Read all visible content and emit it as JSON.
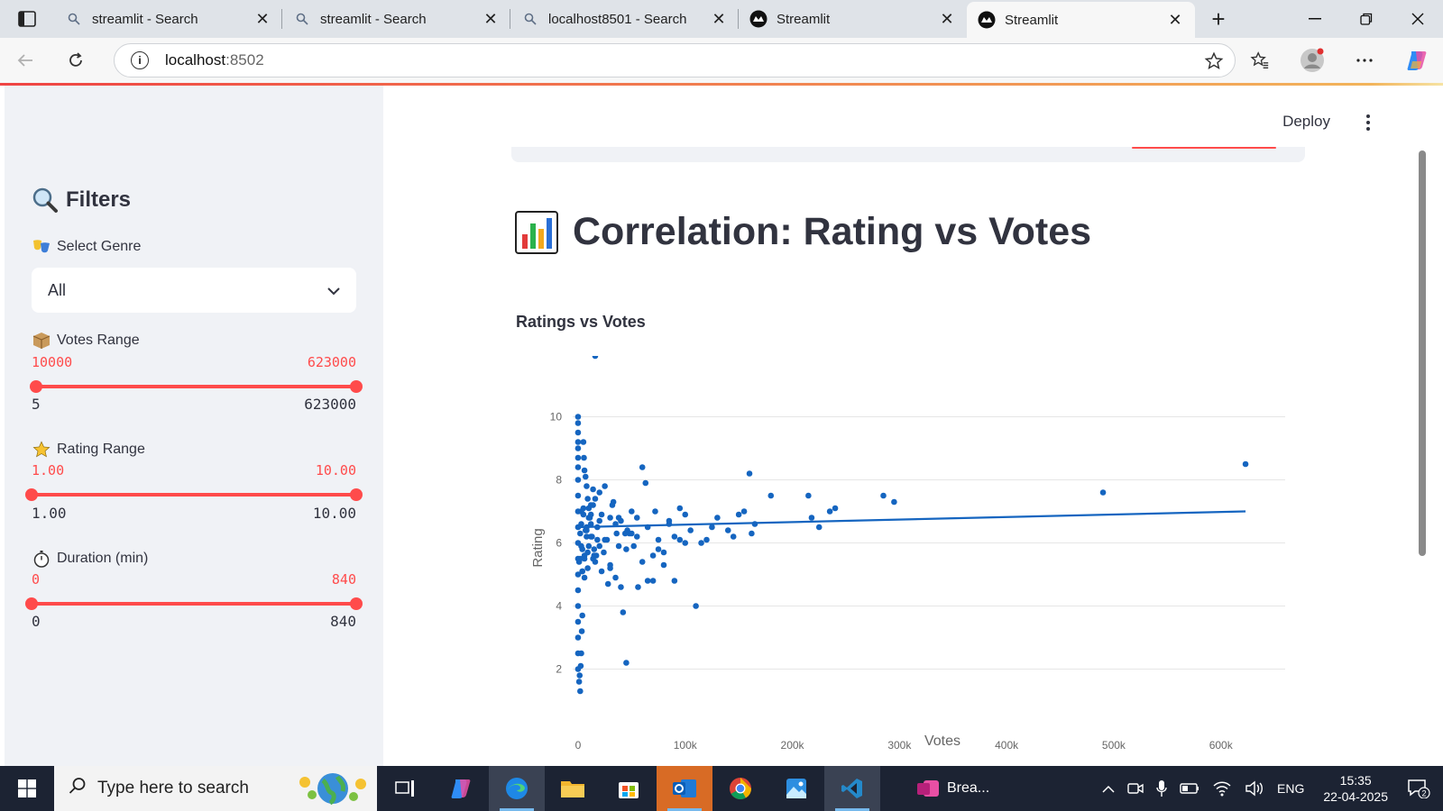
{
  "browser": {
    "tabs": [
      {
        "label": "streamlit - Search",
        "icon": "search-icon"
      },
      {
        "label": "streamlit - Search",
        "icon": "search-icon"
      },
      {
        "label": "localhost8501 - Search",
        "icon": "search-icon"
      },
      {
        "label": "Streamlit",
        "icon": "streamlit-icon"
      },
      {
        "label": "Streamlit",
        "icon": "streamlit-icon",
        "active": true
      }
    ],
    "url_host": "localhost",
    "url_port": ":8502"
  },
  "sidebar": {
    "title": "Filters",
    "genre_label": "Select Genre",
    "genre_value": "All",
    "votes": {
      "label": "Votes Range",
      "low": "10000",
      "high": "623000",
      "min": "5",
      "max": "623000",
      "low_frac": 0.0,
      "high_frac": 1.0
    },
    "rating": {
      "label": "Rating Range",
      "low": "1.00",
      "high": "10.00",
      "min": "1.00",
      "max": "10.00",
      "low_frac": 0.0,
      "high_frac": 1.0
    },
    "duration": {
      "label": "Duration (min)",
      "low": "0",
      "high": "840",
      "min": "0",
      "max": "840",
      "low_frac": 0.0,
      "high_frac": 1.0
    }
  },
  "main": {
    "deploy_label": "Deploy",
    "page_title": "Correlation: Rating vs Votes",
    "chart_title": "Ratings vs Votes"
  },
  "chart_data": {
    "type": "scatter",
    "title": "Ratings vs Votes",
    "xlabel": "Votes",
    "ylabel": "Rating",
    "xlim": [
      -5000,
      660000
    ],
    "ylim": [
      0.5,
      10.5
    ],
    "x_ticks": [
      0,
      100000,
      200000,
      300000,
      400000,
      500000,
      600000
    ],
    "x_tick_labels": [
      "0",
      "100k",
      "200k",
      "300k",
      "400k",
      "500k",
      "600k"
    ],
    "y_ticks": [
      2,
      4,
      6,
      8,
      10
    ],
    "y_tick_labels": [
      "2",
      "4",
      "6",
      "8",
      "10"
    ],
    "grid": true,
    "point_color": "#1565c0",
    "trendline": {
      "x": [
        0,
        623000
      ],
      "y": [
        6.5,
        7.0
      ]
    },
    "points": {
      "x": [
        0,
        0,
        0,
        0,
        0,
        0,
        0,
        0,
        0,
        0,
        0,
        0,
        0,
        0,
        0,
        0,
        0,
        0,
        0,
        0,
        1000,
        1500,
        2000,
        2500,
        3000,
        3500,
        4000,
        5000,
        5500,
        6000,
        7000,
        8000,
        9000,
        10000,
        11000,
        12000,
        14000,
        15000,
        16000,
        18000,
        20000,
        22000,
        25000,
        27000,
        30000,
        32000,
        35000,
        38000,
        40000,
        42000,
        45000,
        48000,
        50000,
        55000,
        60000,
        63000,
        65000,
        70000,
        72000,
        75000,
        80000,
        85000,
        90000,
        95000,
        100000,
        105000,
        110000,
        115000,
        120000,
        125000,
        130000,
        140000,
        145000,
        150000,
        155000,
        160000,
        162000,
        165000,
        180000,
        215000,
        218000,
        225000,
        235000,
        240000,
        285000,
        295000,
        490000,
        623000,
        3000,
        4000,
        6000,
        8000,
        10000,
        12000,
        15000,
        20000,
        25000,
        30000,
        35000,
        40000,
        45000,
        50000,
        55000,
        60000,
        70000,
        80000,
        90000,
        100000,
        5000,
        7000,
        9000,
        13000,
        17000,
        22000,
        28000,
        33000,
        38000,
        44000,
        52000,
        2000,
        3000,
        5000,
        8000,
        12000,
        16000,
        20000,
        4000,
        6000,
        9000,
        14000,
        18000,
        24000,
        30000,
        36000,
        46000,
        56000,
        65000,
        75000,
        85000,
        95000,
        1000,
        2000,
        3000,
        4000,
        6000,
        8000,
        10000,
        12000,
        14000,
        16000
      ],
      "y": [
        10,
        9.8,
        9.5,
        9.2,
        9,
        8.7,
        8.4,
        8,
        7.5,
        7,
        6.5,
        6,
        5.5,
        5,
        4.5,
        4,
        3.5,
        3,
        2.5,
        2,
        1.6,
        1.8,
        1.3,
        2.1,
        2.5,
        3.2,
        3.7,
        9.2,
        8.7,
        8.3,
        8.1,
        7.8,
        7.4,
        7.1,
        6.8,
        6.2,
        7.7,
        5.8,
        5.4,
        6.5,
        7.6,
        6.9,
        7.8,
        6.1,
        5.2,
        7.2,
        6.6,
        5.9,
        4.6,
        3.8,
        2.2,
        6.3,
        7,
        6.8,
        8.4,
        7.9,
        6.5,
        5.6,
        7,
        6.1,
        5.7,
        6.6,
        6.2,
        7.1,
        6.9,
        6.4,
        4,
        6,
        6.1,
        6.5,
        6.8,
        6.4,
        6.2,
        6.9,
        7,
        8.2,
        6.3,
        6.6,
        7.5,
        7.5,
        6.8,
        6.5,
        7,
        7.1,
        7.5,
        7.3,
        7.6,
        8.5,
        5.9,
        5.1,
        5.5,
        6.4,
        6.8,
        7.2,
        5.6,
        5.9,
        6.1,
        5.3,
        4.9,
        6.7,
        5.8,
        6.3,
        6.2,
        5.4,
        4.8,
        5.3,
        4.8,
        6,
        6.9,
        6.4,
        5.7,
        6.2,
        5.6,
        5.1,
        4.7,
        7.3,
        6.8,
        6.3,
        5.9,
        5.5,
        6.6,
        7.1,
        6.5,
        6.9,
        7.4,
        6.7,
        5.8,
        4.9,
        5.2,
        5.5,
        6.1,
        5.7,
        6.8,
        6.3,
        6.4,
        4.6,
        4.8,
        5.8,
        6.7,
        6.1,
        5.4,
        6.3,
        7,
        5.1,
        5.6,
        6.2,
        5.9,
        6.6,
        7.2
      ]
    }
  }
}
